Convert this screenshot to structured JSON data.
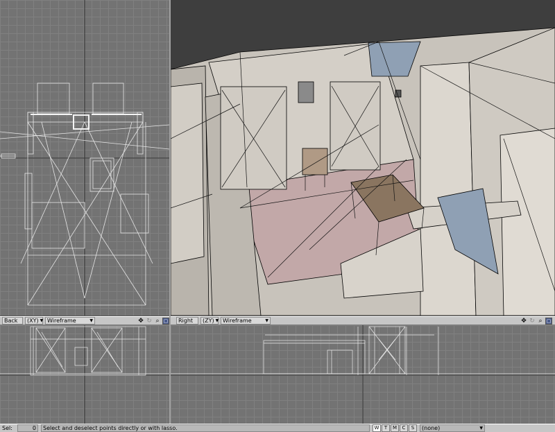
{
  "viewports": {
    "back": {
      "view": "Back",
      "axes": "(XY)",
      "mode": "Wireframe"
    },
    "right": {
      "view": "Right",
      "axes": "(ZY)",
      "mode": "Wireframe"
    }
  },
  "icons": [
    "move-icon",
    "rotate-icon",
    "zoom-icon",
    "maximize-icon"
  ],
  "status": {
    "sel_label": "Sel:",
    "sel_count": "0",
    "message": "Select and deselect points directly or with lasso.",
    "modes": [
      "W",
      "T",
      "M",
      "C",
      "S"
    ],
    "selection_set": "(none)"
  },
  "colors": {
    "grid_bg": "#737373",
    "grid_line": "#808080",
    "wire": "#e8e8e8",
    "panel": "#c6c6c6",
    "floor": "#c2a8a8",
    "table": "#8a7560",
    "blue_surface": "#8fa0b4"
  }
}
